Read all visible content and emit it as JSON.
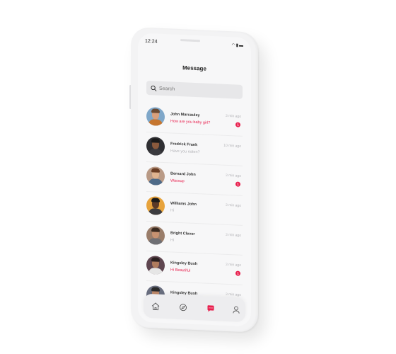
{
  "status_bar": {
    "time": "12:24"
  },
  "header": {
    "title": "Message"
  },
  "search": {
    "placeholder": "Search"
  },
  "conversations": [
    {
      "name": "John Marcauley",
      "message": "How are you baby girl?",
      "time": "3 min ago",
      "unread": true,
      "badge": "1"
    },
    {
      "name": "Fredrick Frank",
      "message": "Have you eaten?",
      "time": "10 min ago",
      "unread": false
    },
    {
      "name": "Bernard John",
      "message": "Wassup",
      "time": "3 min ago",
      "unread": true,
      "badge": "1"
    },
    {
      "name": "Williams John",
      "message": "Hi",
      "time": "3 min ago",
      "unread": false
    },
    {
      "name": "Bright Clever",
      "message": "Hi",
      "time": "3 min ago",
      "unread": false
    },
    {
      "name": "Kingsley Bush",
      "message": "Hi Beautiful",
      "time": "3 min ago",
      "unread": true,
      "badge": "1"
    },
    {
      "name": "Kingsley Bush",
      "message": "",
      "time": "3 min ago",
      "unread": false
    }
  ],
  "tabbar": {
    "items": [
      "home-icon",
      "explore-icon",
      "chat-icon",
      "profile-icon"
    ],
    "active": "chat-icon"
  },
  "colors": {
    "accent": "#e8204e",
    "screen": "#f7f7f8"
  }
}
